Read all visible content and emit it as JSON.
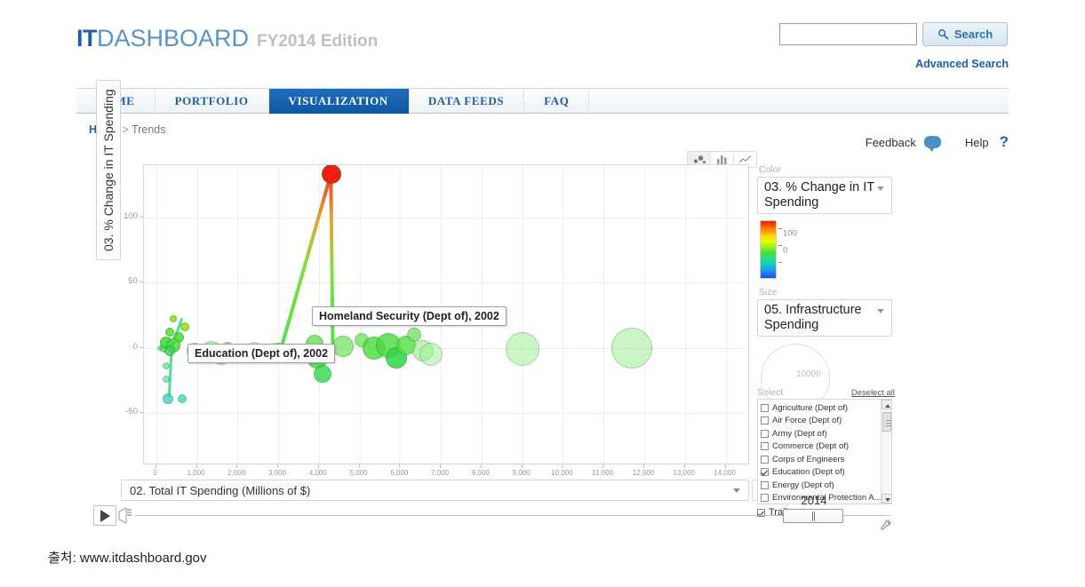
{
  "header": {
    "logo_it": "IT",
    "logo_dashboard": "DASHBOARD",
    "logo_edition": "FY2014 Edition",
    "search_value": "",
    "search_placeholder": "",
    "search_button": "Search",
    "advanced_search": "Advanced Search"
  },
  "nav": {
    "items": [
      {
        "label": "HOME",
        "active": false
      },
      {
        "label": "PORTFOLIO",
        "active": false
      },
      {
        "label": "VISUALIZATION",
        "active": true
      },
      {
        "label": "DATA FEEDS",
        "active": false
      },
      {
        "label": "FAQ",
        "active": false
      }
    ]
  },
  "breadcrumb": {
    "home": "Home",
    "separator": ">",
    "current": "Trends"
  },
  "utility": {
    "feedback": "Feedback",
    "help": "Help",
    "help_mark": "?"
  },
  "chart_toggle": {
    "options": [
      "bubble-chart-icon",
      "bar-chart-icon",
      "line-chart-icon"
    ],
    "selected": "bubble-chart-icon"
  },
  "axes": {
    "y_label": "03. % Change in IT Spending",
    "y_scale": "Lin",
    "y_ticks": [
      "100",
      "50",
      "0",
      "-50"
    ],
    "x_label": "02. Total IT Spending (Millions of $)",
    "x_scale": "Lin",
    "x_ticks": [
      "0",
      "1,000",
      "2,000",
      "3,000",
      "4,000",
      "5,000",
      "6,000",
      "7,000",
      "8,000",
      "9,000",
      "10,000",
      "11,000",
      "12,000",
      "13,000",
      "14,000"
    ]
  },
  "tooltips": [
    {
      "text": "Homeland Security (Dept of), 2002"
    },
    {
      "text": "Education (Dept of), 2002"
    }
  ],
  "panel": {
    "color_caption": "Color",
    "color_value": "03. % Change in IT Spending",
    "color_legend_labels": [
      "100",
      "0"
    ],
    "size_caption": "Size",
    "size_value": "05. Infrastructure Spending",
    "size_legend_label": "10000",
    "select_caption": "Select",
    "deselect_all": "Deselect all",
    "agencies": [
      {
        "label": "Agriculture (Dept of)",
        "checked": false
      },
      {
        "label": "Air Force (Dept of)",
        "checked": false
      },
      {
        "label": "Army (Dept of)",
        "checked": false
      },
      {
        "label": "Commerce (Dept of)",
        "checked": false
      },
      {
        "label": "Corps of Engineers",
        "checked": false
      },
      {
        "label": "Education (Dept of)",
        "checked": true
      },
      {
        "label": "Energy (Dept of)",
        "checked": false
      },
      {
        "label": "Environmental Protection A...",
        "checked": false
      }
    ],
    "trails_label": "Trails",
    "trails_checked": true
  },
  "timeline": {
    "play_label": "play-button",
    "year": "2014",
    "handle_glyph": "||"
  },
  "source": {
    "text": "출처: www.itdashboard.gov"
  },
  "colors": {
    "brand_blue": "#1b5fa8",
    "nav_active": "#0d55a0",
    "accent_bubble": "#4a90c4",
    "bubble_green": "#5ce05c",
    "bubble_red": "#f02020"
  },
  "chart_data": {
    "type": "scatter",
    "title": "",
    "xlabel": "02. Total IT Spending (Millions of $)",
    "ylabel": "03. % Change in IT Spending",
    "xlim": [
      -300,
      14600
    ],
    "ylim": [
      -90,
      140
    ],
    "grid": true,
    "legend": "right",
    "color_encoding": "03. % Change in IT Spending",
    "size_encoding": "05. Infrastructure Spending",
    "year": 2014,
    "points": [
      {
        "x": 4300,
        "y": 133,
        "r": 11,
        "c": "#f21d10",
        "o": 1.0
      },
      {
        "x": 420,
        "y": 22,
        "r": 4,
        "c": "#8fe000",
        "o": 0.85
      },
      {
        "x": 700,
        "y": 16,
        "r": 5,
        "c": "#9ee008",
        "o": 0.85
      },
      {
        "x": 340,
        "y": 12,
        "r": 5,
        "c": "#55e02b",
        "o": 0.85
      },
      {
        "x": 560,
        "y": 8,
        "r": 6,
        "c": "#4ddb2a",
        "o": 0.85
      },
      {
        "x": 250,
        "y": 4,
        "r": 7,
        "c": "#3fd93f",
        "o": 0.85
      },
      {
        "x": 430,
        "y": 2,
        "r": 8,
        "c": "#47dd35",
        "o": 0.85
      },
      {
        "x": 100,
        "y": 0,
        "r": 3,
        "c": "#55dd55",
        "o": 0.7
      },
      {
        "x": 180,
        "y": -1,
        "r": 4,
        "c": "#4fd94f",
        "o": 0.7
      },
      {
        "x": 330,
        "y": -2,
        "r": 6,
        "c": "#3fd060",
        "o": 0.8
      },
      {
        "x": 940,
        "y": -2,
        "r": 9,
        "c": "#8ce87e",
        "o": 0.6
      },
      {
        "x": 1350,
        "y": -3,
        "r": 12,
        "c": "#8fe884",
        "o": 0.6
      },
      {
        "x": 1750,
        "y": 0,
        "r": 7,
        "c": "#6fe05a",
        "o": 0.7
      },
      {
        "x": 1600,
        "y": -6,
        "r": 10,
        "c": "#80e474",
        "o": 0.55
      },
      {
        "x": 2400,
        "y": -3,
        "r": 11,
        "c": "#9aeb90",
        "o": 0.55
      },
      {
        "x": 2750,
        "y": -4,
        "r": 7,
        "c": "#9aeb90",
        "o": 0.55
      },
      {
        "x": 3080,
        "y": -2,
        "r": 4,
        "c": "#a8eea0",
        "o": 0.6
      },
      {
        "x": 3900,
        "y": 3,
        "r": 10,
        "c": "#55e046",
        "o": 0.75
      },
      {
        "x": 3950,
        "y": -8,
        "r": 12,
        "c": "#3ed93e",
        "o": 0.8
      },
      {
        "x": 4100,
        "y": -20,
        "r": 10,
        "c": "#2fd94a",
        "o": 0.8
      },
      {
        "x": 4600,
        "y": 1,
        "r": 12,
        "c": "#6ae05c",
        "o": 0.7
      },
      {
        "x": 5050,
        "y": 6,
        "r": 8,
        "c": "#62e052",
        "o": 0.7
      },
      {
        "x": 5350,
        "y": 0,
        "r": 13,
        "c": "#4adb3e",
        "o": 0.8
      },
      {
        "x": 5700,
        "y": 2,
        "r": 14,
        "c": "#4adb3e",
        "o": 0.8
      },
      {
        "x": 5900,
        "y": -8,
        "r": 12,
        "c": "#2fd648",
        "o": 0.85
      },
      {
        "x": 6150,
        "y": 2,
        "r": 11,
        "c": "#55e045",
        "o": 0.8
      },
      {
        "x": 6350,
        "y": 10,
        "r": 8,
        "c": "#6de05a",
        "o": 0.75
      },
      {
        "x": 6550,
        "y": -2,
        "r": 12,
        "c": "#95ea86",
        "o": 0.6
      },
      {
        "x": 6750,
        "y": -5,
        "r": 13,
        "c": "#a2edA0",
        "o": 0.55
      },
      {
        "x": 9000,
        "y": -1,
        "r": 19,
        "c": "#a9eea3",
        "o": 0.6
      },
      {
        "x": 11700,
        "y": 0,
        "r": 23,
        "c": "#a9eea3",
        "o": 0.6
      },
      {
        "x": 250,
        "y": -14,
        "r": 4,
        "c": "#3fd97a",
        "o": 0.6
      },
      {
        "x": 250,
        "y": -24,
        "r": 4,
        "c": "#33d6a0",
        "o": 0.6
      },
      {
        "x": 300,
        "y": -39,
        "r": 6,
        "c": "#2fd4c8",
        "o": 0.75
      },
      {
        "x": 640,
        "y": -39,
        "r": 5,
        "c": "#32d2c0",
        "o": 0.75
      }
    ],
    "trails": [
      {
        "name": "Homeland Security (Dept of)",
        "path": [
          [
            1400,
            -3
          ],
          [
            3100,
            2
          ],
          [
            4300,
            133
          ],
          [
            4350,
            -5
          ]
        ]
      },
      {
        "name": "Education (Dept of)",
        "path": [
          [
            300,
            -39
          ],
          [
            360,
            -2
          ],
          [
            500,
            12
          ],
          [
            620,
            22
          ]
        ]
      }
    ]
  }
}
